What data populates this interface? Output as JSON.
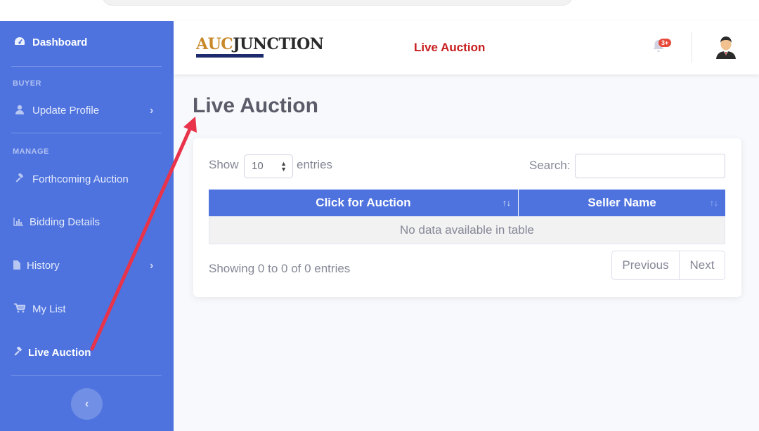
{
  "sidebar": {
    "dashboard": "Dashboard",
    "heading_buyer": "BUYER",
    "update_profile": "Update Profile",
    "heading_manage": "MANAGE",
    "forthcoming_auction": "Forthcoming Auction",
    "bidding_details": "Bidding Details",
    "history": "History",
    "my_list": "My List",
    "live_auction": "Live Auction",
    "toggle_icon": "chevron-left-icon"
  },
  "topbar": {
    "logo_part1": "AUC",
    "logo_part2": "JUNCTION",
    "title": "Live Auction",
    "notification_badge": "3+"
  },
  "main": {
    "page_title": "Live Auction",
    "show_label": "Show",
    "page_size": "10",
    "entries_label": "entries",
    "search_label": "Search:",
    "search_value": "",
    "columns": [
      "Click for Auction",
      "Seller Name"
    ],
    "empty_message": "No data available in table",
    "info": "Showing 0 to 0 of 0 entries",
    "prev_label": "Previous",
    "next_label": "Next"
  },
  "colors": {
    "sidebar": "#4e73df",
    "accent_red": "#c81e1e",
    "annotation_arrow": "#e8334a"
  }
}
